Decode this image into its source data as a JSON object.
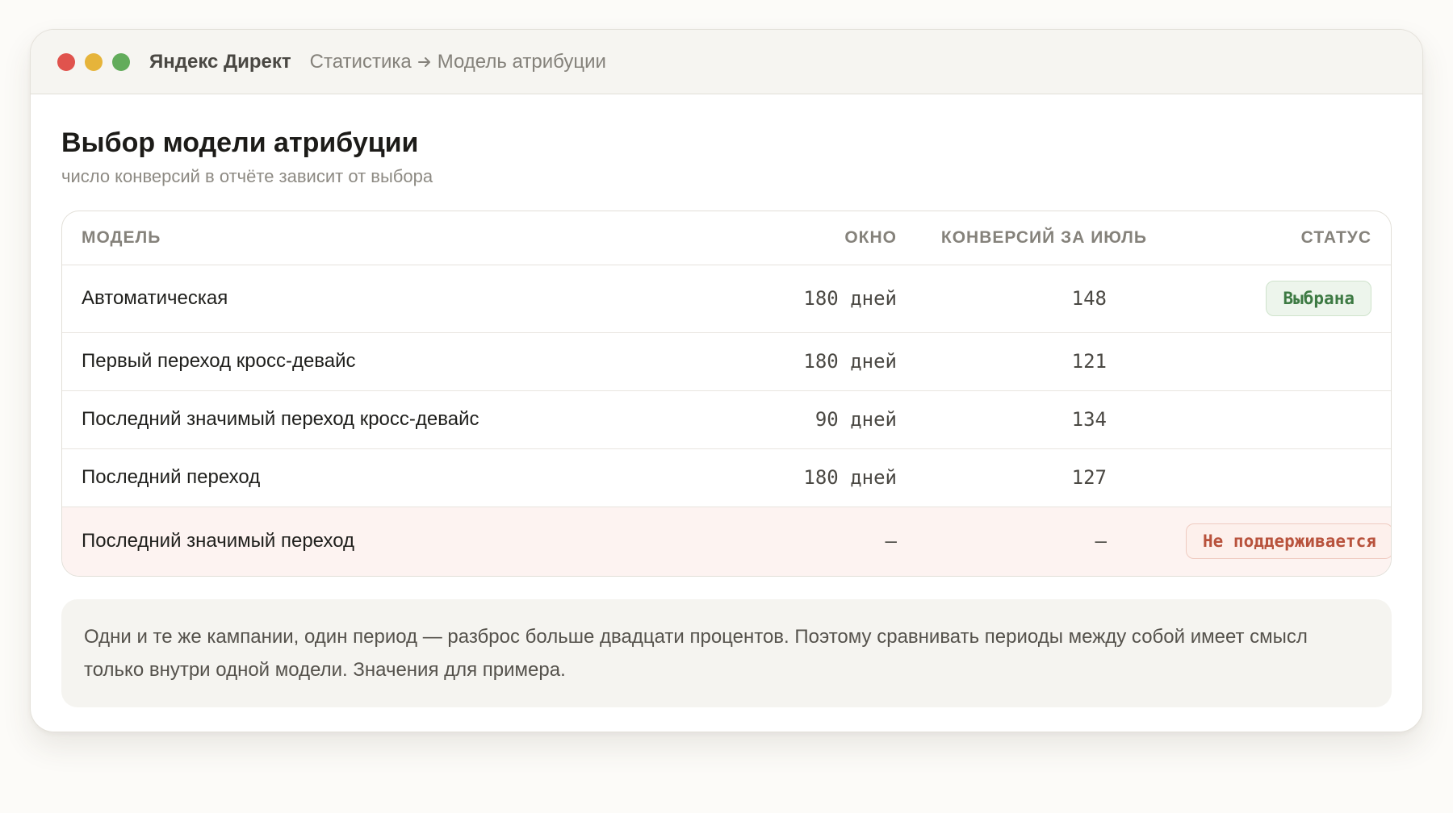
{
  "window": {
    "app_name": "Яндекс Директ",
    "breadcrumb": {
      "section": "Статистика",
      "separator_icon": "arrow-right-icon",
      "page": "Модель атрибуции"
    },
    "traffic_lights": {
      "close": "#e0534d",
      "minimize": "#e6b43a",
      "maximize": "#62ac5b"
    }
  },
  "page": {
    "title": "Выбор модели атрибуции",
    "subtitle": "число конверсий в отчёте зависит от выбора"
  },
  "table": {
    "headers": {
      "model": "Модель",
      "window": "Окно",
      "conversions": "Конверсий за июль",
      "status": "Статус"
    },
    "rows": [
      {
        "model": "Автоматическая",
        "window": "180 дней",
        "conversions": "148",
        "status": "Выбрана"
      },
      {
        "model": "Первый переход кросс-девайс",
        "window": "180 дней",
        "conversions": "121",
        "status": ""
      },
      {
        "model": "Последний значимый переход кросс-девайс",
        "window": "90 дней",
        "conversions": "134",
        "status": ""
      },
      {
        "model": "Последний переход",
        "window": "180 дней",
        "conversions": "127",
        "status": ""
      },
      {
        "model": "Последний значимый переход",
        "window": "—",
        "conversions": "—",
        "status": "Не поддерживается"
      }
    ]
  },
  "note": {
    "text": "Одни и те же кампании, один период — разброс больше двадцати процентов. Поэтому сравнивать периоды между собой имеет смысл только внутри одной модели. Значения для примера."
  },
  "colors": {
    "selected_badge": "#3d7a43",
    "unsupported_badge": "#b8523c",
    "unsupported_row_bg": "#fdf3f1"
  }
}
